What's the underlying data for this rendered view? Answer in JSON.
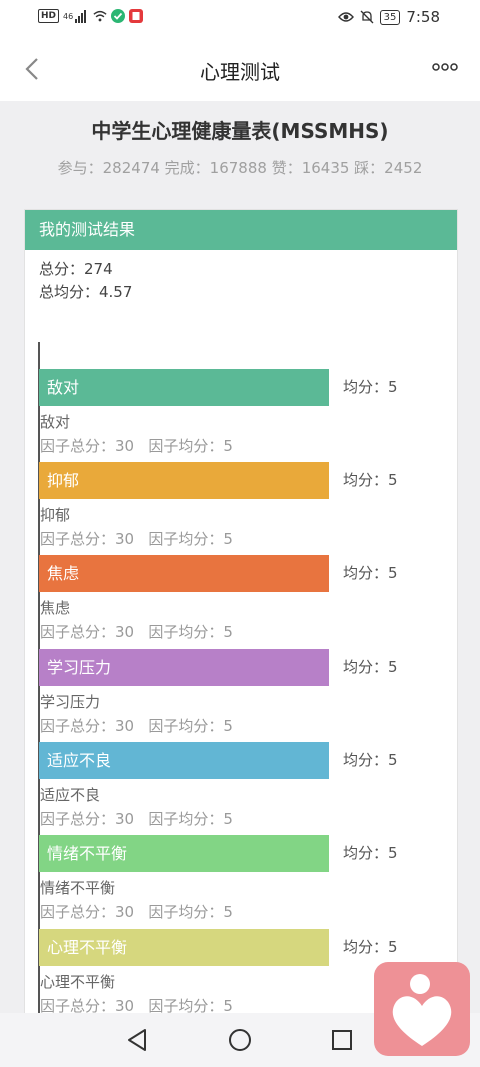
{
  "status_bar": {
    "left": {
      "hd": "HD",
      "signal": "46"
    },
    "time": "7:58",
    "battery": "35"
  },
  "header": {
    "title": "心理测试"
  },
  "scale": {
    "title": "中学生心理健康量表(MSSMHS)",
    "stats": "参与：282474 完成：167888 赞：16435 踩：2452"
  },
  "result": {
    "heading": "我的测试结果",
    "total": "总分：274",
    "average": "总均分：4.57"
  },
  "factors": [
    {
      "label": "敌对",
      "avg": "均分：5",
      "name": "敌对",
      "detail": "因子总分：30   因子均分：5",
      "color": "#5bb996"
    },
    {
      "label": "抑郁",
      "avg": "均分：5",
      "name": "抑郁",
      "detail": "因子总分：30   因子均分：5",
      "color": "#e9a93a"
    },
    {
      "label": "焦虑",
      "avg": "均分：5",
      "name": "焦虑",
      "detail": "因子总分：30   因子均分：5",
      "color": "#e8743f"
    },
    {
      "label": "学习压力",
      "avg": "均分：5",
      "name": "学习压力",
      "detail": "因子总分：30   因子均分：5",
      "color": "#b780c8"
    },
    {
      "label": "适应不良",
      "avg": "均分：5",
      "name": "适应不良",
      "detail": "因子总分：30   因子均分：5",
      "color": "#62b6d4"
    },
    {
      "label": "情绪不平衡",
      "avg": "均分：5",
      "name": "情绪不平衡",
      "detail": "因子总分：30   因子均分：5",
      "color": "#82d585"
    },
    {
      "label": "心理不平衡",
      "avg": "均分：5",
      "name": "心理不平衡",
      "detail": "因子总分：30   因子均分：5",
      "color": "#d6d77e"
    }
  ],
  "icons": {
    "back": "chevron-left-icon",
    "more": "more-dots-icon",
    "nav_back": "triangle-back-icon",
    "nav_home": "circle-home-icon",
    "nav_recent": "square-recent-icon",
    "float": "heart-person-icon"
  },
  "colors": {
    "header_green": "#5bb996",
    "float_pink": "#ee9196"
  }
}
